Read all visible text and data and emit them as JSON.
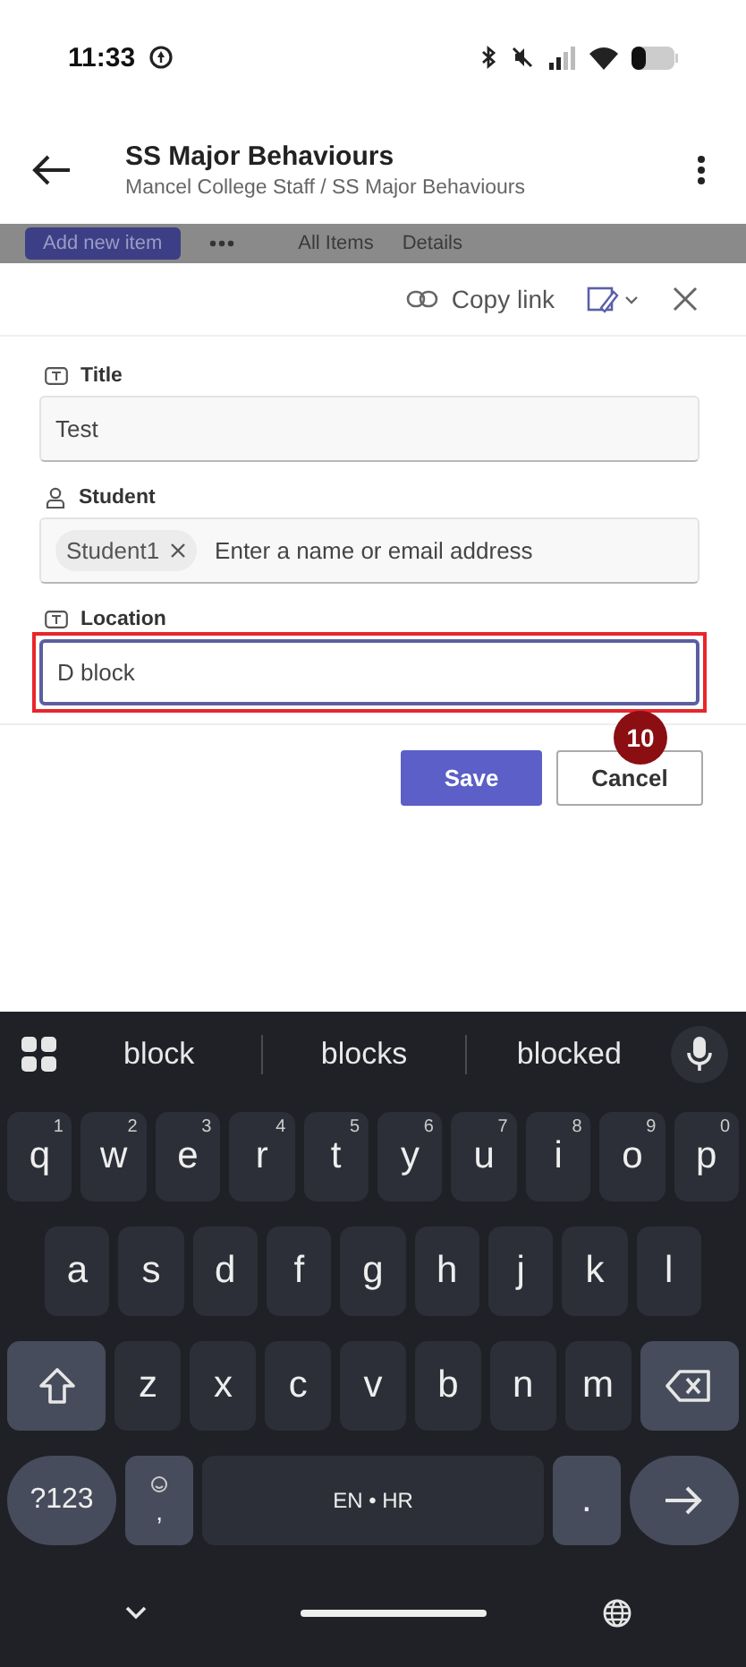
{
  "status_bar": {
    "time": "11:33"
  },
  "header": {
    "title": "SS Major Behaviours",
    "breadcrumb": "Mancel College Staff / SS Major Behaviours"
  },
  "toolbar": {
    "items": [
      {
        "kind": "primary",
        "label": "Add new item"
      },
      {
        "kind": "more"
      },
      {
        "kind": "view",
        "label": "All Items"
      },
      {
        "kind": "details",
        "label": "Details"
      }
    ]
  },
  "panel": {
    "copy_link": "Copy link",
    "fields": [
      {
        "kind": "text",
        "label": "Title",
        "value": "Test",
        "focused": false,
        "highlighted": false
      },
      {
        "kind": "person",
        "label": "Student",
        "chips": [
          {
            "label": "Student1"
          }
        ],
        "placeholder": "Enter a name or email address",
        "focused": false,
        "highlighted": false
      },
      {
        "kind": "text",
        "label": "Location",
        "value": "D block",
        "focused": true,
        "highlighted": true
      }
    ],
    "buttons": [
      {
        "kind": "primary",
        "label": "Save"
      },
      {
        "kind": "secondary",
        "label": "Cancel"
      }
    ],
    "step_badge": "10"
  },
  "keyboard": {
    "suggestions": [
      "block",
      "blocks",
      "blocked"
    ],
    "rows": [
      {
        "keys": [
          {
            "kind": "letter",
            "label": "q",
            "hint": "1"
          },
          {
            "kind": "letter",
            "label": "w",
            "hint": "2"
          },
          {
            "kind": "letter",
            "label": "e",
            "hint": "3"
          },
          {
            "kind": "letter",
            "label": "r",
            "hint": "4"
          },
          {
            "kind": "letter",
            "label": "t",
            "hint": "5"
          },
          {
            "kind": "letter",
            "label": "y",
            "hint": "6"
          },
          {
            "kind": "letter",
            "label": "u",
            "hint": "7"
          },
          {
            "kind": "letter",
            "label": "i",
            "hint": "8"
          },
          {
            "kind": "letter",
            "label": "o",
            "hint": "9"
          },
          {
            "kind": "letter",
            "label": "p",
            "hint": "0"
          }
        ]
      },
      {
        "keys": [
          {
            "kind": "letter",
            "label": "a"
          },
          {
            "kind": "letter",
            "label": "s"
          },
          {
            "kind": "letter",
            "label": "d"
          },
          {
            "kind": "letter",
            "label": "f"
          },
          {
            "kind": "letter",
            "label": "g"
          },
          {
            "kind": "letter",
            "label": "h"
          },
          {
            "kind": "letter",
            "label": "j"
          },
          {
            "kind": "letter",
            "label": "k"
          },
          {
            "kind": "letter",
            "label": "l"
          }
        ]
      },
      {
        "keys": [
          {
            "kind": "shift"
          },
          {
            "kind": "letter",
            "label": "z"
          },
          {
            "kind": "letter",
            "label": "x"
          },
          {
            "kind": "letter",
            "label": "c"
          },
          {
            "kind": "letter",
            "label": "v"
          },
          {
            "kind": "letter",
            "label": "b"
          },
          {
            "kind": "letter",
            "label": "n"
          },
          {
            "kind": "letter",
            "label": "m"
          },
          {
            "kind": "backspace"
          }
        ]
      },
      {
        "keys": [
          {
            "kind": "symbols",
            "label": "?123"
          },
          {
            "kind": "comma",
            "label": ","
          },
          {
            "kind": "space",
            "label": "EN • HR"
          },
          {
            "kind": "period",
            "label": "."
          },
          {
            "kind": "enter"
          }
        ]
      }
    ]
  }
}
